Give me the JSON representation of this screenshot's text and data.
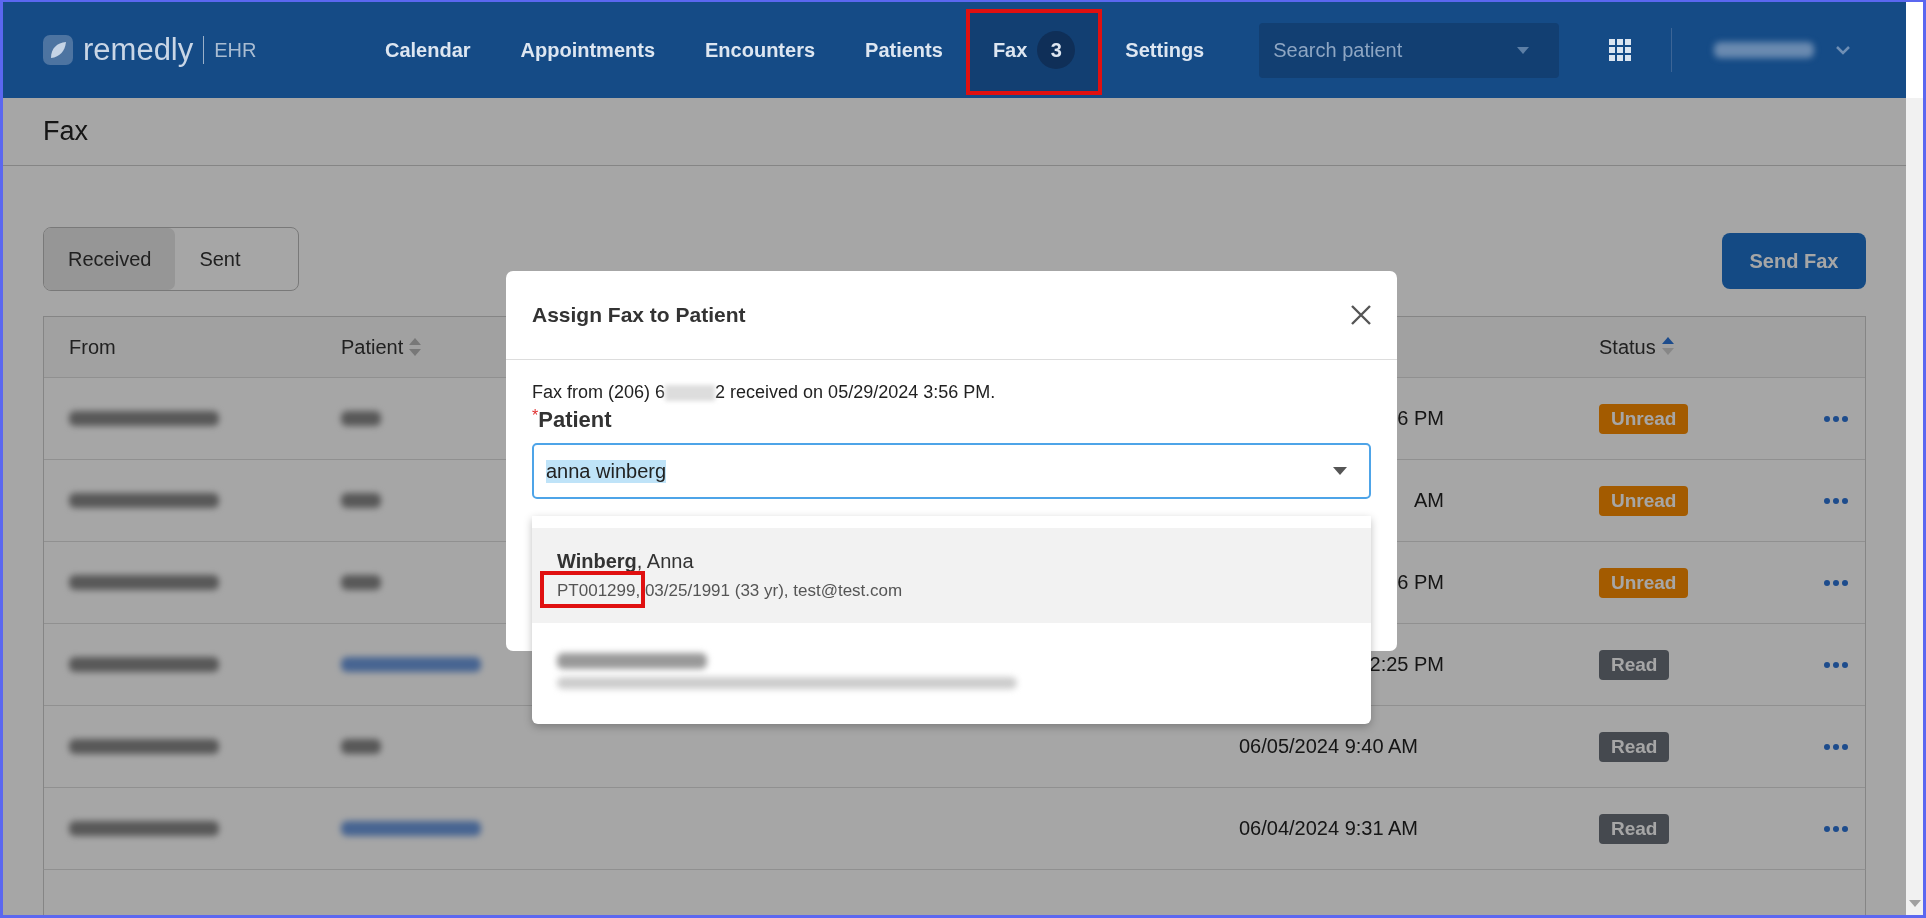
{
  "brand": {
    "name": "remedly",
    "product": "EHR"
  },
  "nav": [
    {
      "label": "Calendar",
      "selected": false
    },
    {
      "label": "Appointments",
      "selected": false
    },
    {
      "label": "Encounters",
      "selected": false
    },
    {
      "label": "Patients",
      "selected": false
    },
    {
      "label": "Fax",
      "selected": true,
      "badge": "3",
      "annotated": true
    },
    {
      "label": "Settings",
      "selected": false
    }
  ],
  "search": {
    "placeholder": "Search patient"
  },
  "page_title": "Fax",
  "tabs": [
    {
      "label": "Received",
      "selected": true
    },
    {
      "label": "Sent",
      "selected": false
    }
  ],
  "send_button": "Send Fax",
  "table": {
    "columns": [
      {
        "label": "From",
        "sortable": false
      },
      {
        "label": "Patient",
        "sortable": true,
        "sorted": false
      },
      {
        "label": "Status",
        "sortable": true,
        "sorted": true
      }
    ],
    "rows": [
      {
        "patient_linked": false,
        "date": "6 PM",
        "date_cut": true,
        "status": "Unread",
        "unread": true
      },
      {
        "patient_linked": false,
        "date": "AM",
        "date_cut": true,
        "status": "Unread",
        "unread": true
      },
      {
        "patient_linked": false,
        "date": "6 PM",
        "date_cut": true,
        "status": "Unread",
        "unread": true
      },
      {
        "patient_linked": true,
        "date": "2:25 PM",
        "date_cut": true,
        "status": "Read",
        "unread": false
      },
      {
        "patient_linked": false,
        "date": "06/05/2024 9:40 AM",
        "date_cut": false,
        "status": "Read",
        "unread": false
      },
      {
        "patient_linked": true,
        "date": "06/04/2024 9:31 AM",
        "date_cut": false,
        "status": "Read",
        "unread": false
      }
    ]
  },
  "modal": {
    "title": "Assign Fax to Patient",
    "fax_info": [
      "Fax from (206) 6",
      "2 received on 05/29/2024 3:56 PM."
    ],
    "field_label": "Patient",
    "required_mark": "*",
    "field_value": "anna winberg",
    "options": [
      {
        "kind": "result",
        "selected": true,
        "name": "Winberg",
        "name_rest": ", Anna",
        "id": "PT001299,",
        "id_annotated": true,
        "details": " 03/25/1991 (33 yr), test@test.com"
      },
      {
        "kind": "blurred",
        "selected": false
      }
    ]
  }
}
